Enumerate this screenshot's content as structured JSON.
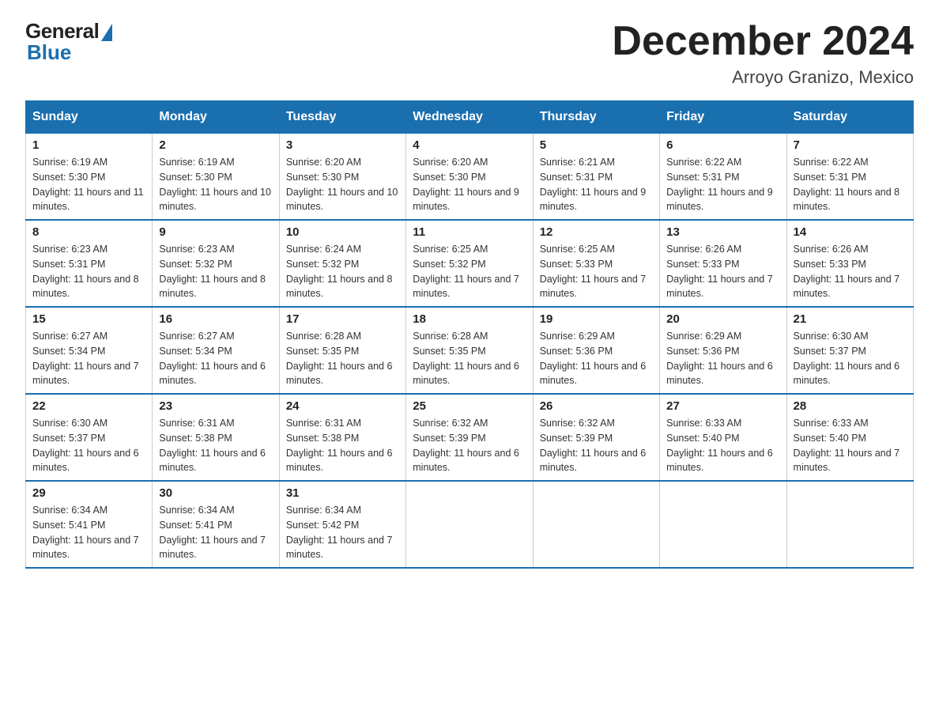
{
  "header": {
    "logo_general": "General",
    "logo_blue": "Blue",
    "title": "December 2024",
    "location": "Arroyo Granizo, Mexico"
  },
  "weekdays": [
    "Sunday",
    "Monday",
    "Tuesday",
    "Wednesday",
    "Thursday",
    "Friday",
    "Saturday"
  ],
  "weeks": [
    [
      {
        "num": "1",
        "sunrise": "6:19 AM",
        "sunset": "5:30 PM",
        "daylight": "11 hours and 11 minutes."
      },
      {
        "num": "2",
        "sunrise": "6:19 AM",
        "sunset": "5:30 PM",
        "daylight": "11 hours and 10 minutes."
      },
      {
        "num": "3",
        "sunrise": "6:20 AM",
        "sunset": "5:30 PM",
        "daylight": "11 hours and 10 minutes."
      },
      {
        "num": "4",
        "sunrise": "6:20 AM",
        "sunset": "5:30 PM",
        "daylight": "11 hours and 9 minutes."
      },
      {
        "num": "5",
        "sunrise": "6:21 AM",
        "sunset": "5:31 PM",
        "daylight": "11 hours and 9 minutes."
      },
      {
        "num": "6",
        "sunrise": "6:22 AM",
        "sunset": "5:31 PM",
        "daylight": "11 hours and 9 minutes."
      },
      {
        "num": "7",
        "sunrise": "6:22 AM",
        "sunset": "5:31 PM",
        "daylight": "11 hours and 8 minutes."
      }
    ],
    [
      {
        "num": "8",
        "sunrise": "6:23 AM",
        "sunset": "5:31 PM",
        "daylight": "11 hours and 8 minutes."
      },
      {
        "num": "9",
        "sunrise": "6:23 AM",
        "sunset": "5:32 PM",
        "daylight": "11 hours and 8 minutes."
      },
      {
        "num": "10",
        "sunrise": "6:24 AM",
        "sunset": "5:32 PM",
        "daylight": "11 hours and 8 minutes."
      },
      {
        "num": "11",
        "sunrise": "6:25 AM",
        "sunset": "5:32 PM",
        "daylight": "11 hours and 7 minutes."
      },
      {
        "num": "12",
        "sunrise": "6:25 AM",
        "sunset": "5:33 PM",
        "daylight": "11 hours and 7 minutes."
      },
      {
        "num": "13",
        "sunrise": "6:26 AM",
        "sunset": "5:33 PM",
        "daylight": "11 hours and 7 minutes."
      },
      {
        "num": "14",
        "sunrise": "6:26 AM",
        "sunset": "5:33 PM",
        "daylight": "11 hours and 7 minutes."
      }
    ],
    [
      {
        "num": "15",
        "sunrise": "6:27 AM",
        "sunset": "5:34 PM",
        "daylight": "11 hours and 7 minutes."
      },
      {
        "num": "16",
        "sunrise": "6:27 AM",
        "sunset": "5:34 PM",
        "daylight": "11 hours and 6 minutes."
      },
      {
        "num": "17",
        "sunrise": "6:28 AM",
        "sunset": "5:35 PM",
        "daylight": "11 hours and 6 minutes."
      },
      {
        "num": "18",
        "sunrise": "6:28 AM",
        "sunset": "5:35 PM",
        "daylight": "11 hours and 6 minutes."
      },
      {
        "num": "19",
        "sunrise": "6:29 AM",
        "sunset": "5:36 PM",
        "daylight": "11 hours and 6 minutes."
      },
      {
        "num": "20",
        "sunrise": "6:29 AM",
        "sunset": "5:36 PM",
        "daylight": "11 hours and 6 minutes."
      },
      {
        "num": "21",
        "sunrise": "6:30 AM",
        "sunset": "5:37 PM",
        "daylight": "11 hours and 6 minutes."
      }
    ],
    [
      {
        "num": "22",
        "sunrise": "6:30 AM",
        "sunset": "5:37 PM",
        "daylight": "11 hours and 6 minutes."
      },
      {
        "num": "23",
        "sunrise": "6:31 AM",
        "sunset": "5:38 PM",
        "daylight": "11 hours and 6 minutes."
      },
      {
        "num": "24",
        "sunrise": "6:31 AM",
        "sunset": "5:38 PM",
        "daylight": "11 hours and 6 minutes."
      },
      {
        "num": "25",
        "sunrise": "6:32 AM",
        "sunset": "5:39 PM",
        "daylight": "11 hours and 6 minutes."
      },
      {
        "num": "26",
        "sunrise": "6:32 AM",
        "sunset": "5:39 PM",
        "daylight": "11 hours and 6 minutes."
      },
      {
        "num": "27",
        "sunrise": "6:33 AM",
        "sunset": "5:40 PM",
        "daylight": "11 hours and 6 minutes."
      },
      {
        "num": "28",
        "sunrise": "6:33 AM",
        "sunset": "5:40 PM",
        "daylight": "11 hours and 7 minutes."
      }
    ],
    [
      {
        "num": "29",
        "sunrise": "6:34 AM",
        "sunset": "5:41 PM",
        "daylight": "11 hours and 7 minutes."
      },
      {
        "num": "30",
        "sunrise": "6:34 AM",
        "sunset": "5:41 PM",
        "daylight": "11 hours and 7 minutes."
      },
      {
        "num": "31",
        "sunrise": "6:34 AM",
        "sunset": "5:42 PM",
        "daylight": "11 hours and 7 minutes."
      },
      null,
      null,
      null,
      null
    ]
  ]
}
